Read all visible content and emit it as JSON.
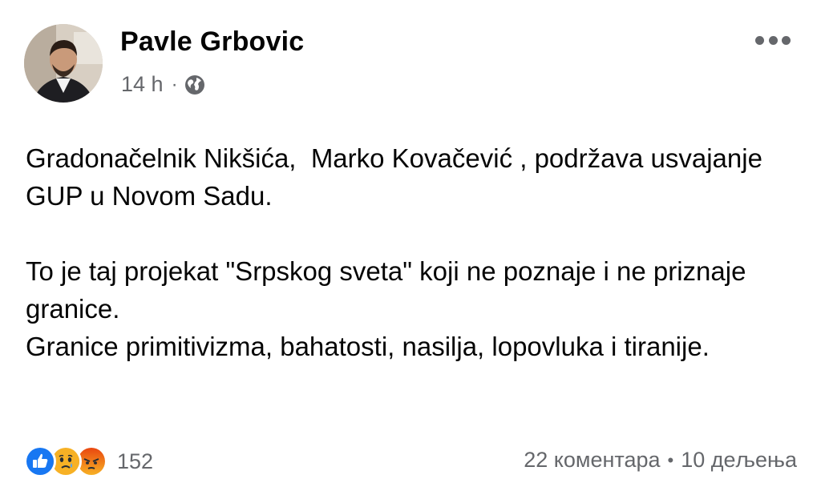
{
  "post": {
    "author": "Pavle Grbovic",
    "timestamp": "14 h",
    "separator": "·",
    "privacy_icon": "globe-icon",
    "more_icon": "more-options-icon",
    "body": [
      "Gradonačelnik Nikšića,  Marko Kovačević , podržava usvajanje GUP u Novom Sadu.",
      "To je taj projekat \"Srpskog sveta\" koji ne poznaje i ne priznaje granice.",
      "Granice primitivizma, bahatosti, nasilja, lopovluka i tiranije."
    ]
  },
  "footer": {
    "reactions": [
      "like-icon",
      "sad-icon",
      "angry-icon"
    ],
    "reaction_count": "152",
    "comments": "22 коментара",
    "stats_separator": "•",
    "shares": "10 дељења"
  },
  "colors": {
    "text": "#050505",
    "secondary": "#65676b",
    "like": "#1877f2",
    "sad": "#f7b125",
    "angry": "#e9710f"
  }
}
